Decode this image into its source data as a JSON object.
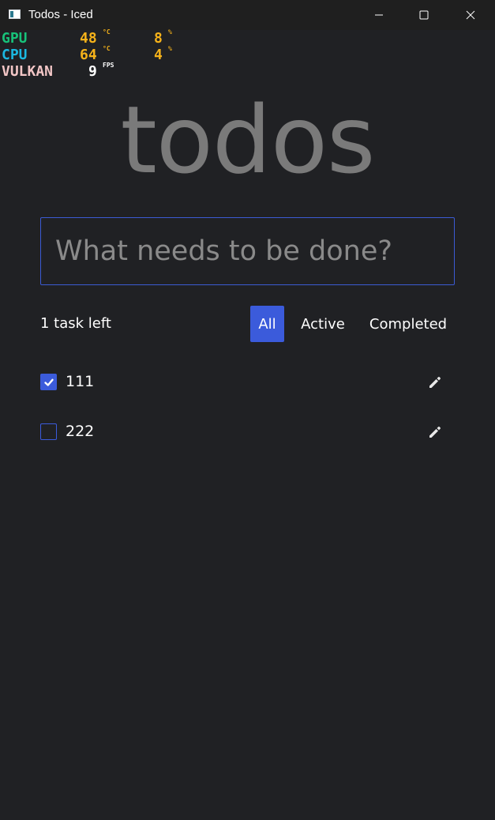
{
  "window": {
    "title": "Todos - Iced"
  },
  "overlay": {
    "gpu": {
      "label": "GPU",
      "temp": "48",
      "temp_unit": "°C",
      "load": "8",
      "load_unit": "%",
      "color": "#17c27a"
    },
    "cpu": {
      "label": "CPU",
      "temp": "64",
      "temp_unit": "°C",
      "load": "4",
      "load_unit": "%",
      "color": "#1bb8e0"
    },
    "api": {
      "label": "VULKAN",
      "fps": "9",
      "fps_unit": "FPS",
      "color": "#f2c6c6"
    }
  },
  "app": {
    "heading": "todos",
    "input": {
      "placeholder": "What needs to be done?",
      "value": ""
    },
    "tasks_left": "1 task left",
    "filters": [
      {
        "label": "All",
        "selected": true
      },
      {
        "label": "Active",
        "selected": false
      },
      {
        "label": "Completed",
        "selected": false
      }
    ],
    "todos": [
      {
        "text": "111",
        "completed": true
      },
      {
        "text": "222",
        "completed": false
      }
    ]
  },
  "colors": {
    "accent": "#3b5bdb",
    "background": "#202124",
    "heading": "#7a7a7a"
  }
}
